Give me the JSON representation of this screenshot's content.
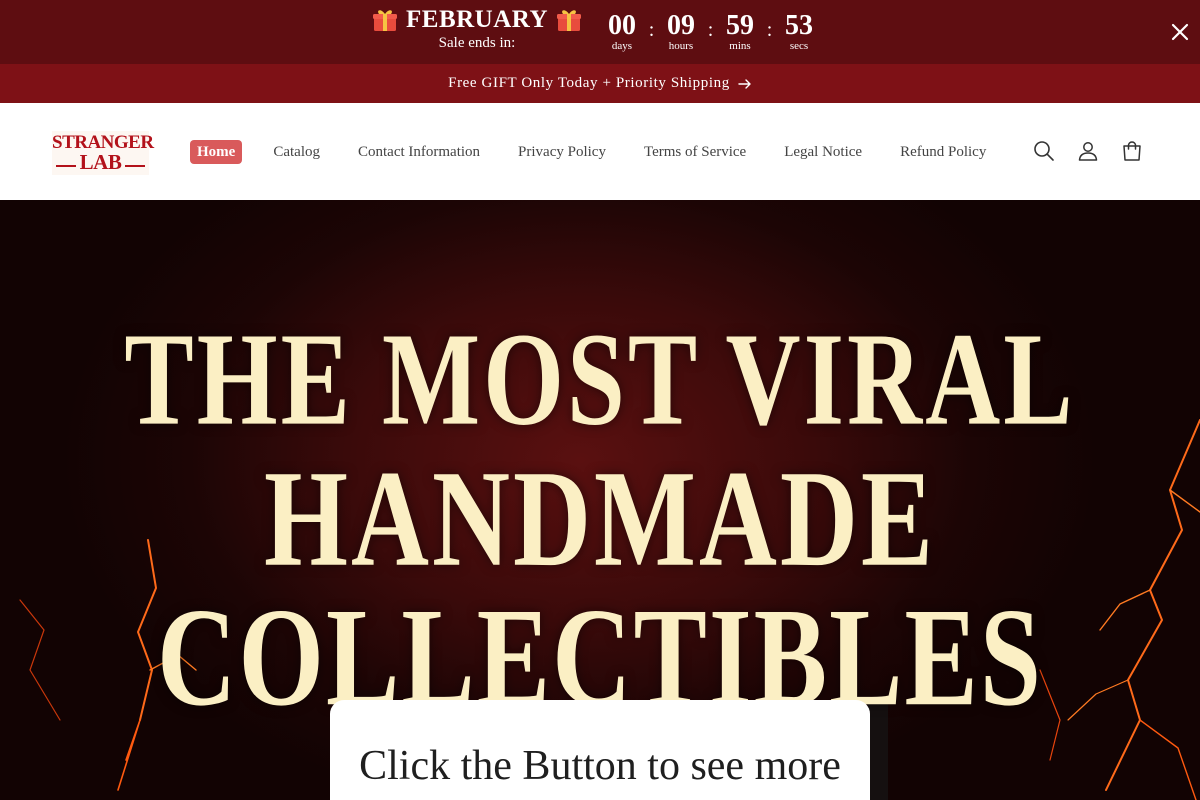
{
  "countdown": {
    "title": "FEBRUARY",
    "subtitle": "Sale ends in:",
    "days": "00",
    "days_label": "days",
    "hours": "09",
    "hours_label": "hours",
    "mins": "59",
    "mins_label": "mins",
    "secs": "53",
    "secs_label": "secs",
    "separator": ":",
    "bg_color": "#5e0d11"
  },
  "announcement": {
    "text": "Free GIFT Only Today + Priority Shipping",
    "bg_color": "#7e1116"
  },
  "header": {
    "logo_line1": "STRANGER",
    "logo_line2": "LAB",
    "nav": [
      {
        "label": "Home",
        "active": true
      },
      {
        "label": "Catalog"
      },
      {
        "label": "Contact Information"
      },
      {
        "label": "Privacy Policy"
      },
      {
        "label": "Terms of Service"
      },
      {
        "label": "Legal Notice"
      },
      {
        "label": "Refund Policy"
      }
    ],
    "icons": [
      "search-icon",
      "account-icon",
      "cart-icon"
    ],
    "accent_color": "#d95a5b"
  },
  "hero": {
    "line1": "THE MOST VIRAL",
    "line2": "HANDMADE",
    "line3": "COLLECTIBLES",
    "text_color": "#fbefc4"
  },
  "cta": {
    "title": "Click the Button to see more"
  }
}
